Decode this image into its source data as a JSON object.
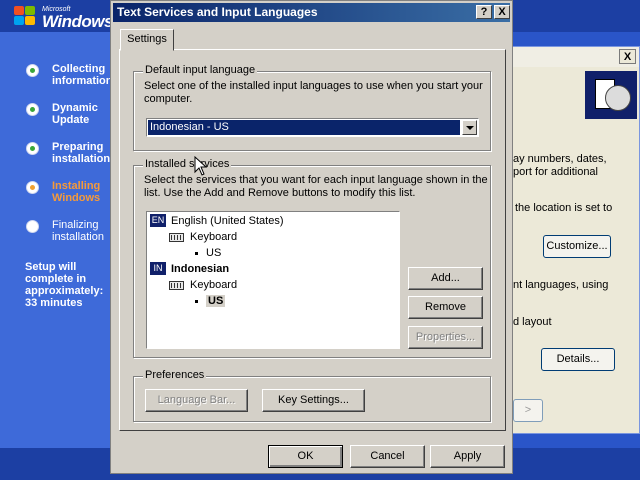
{
  "setup": {
    "logo_microsoft": "Microsoft",
    "logo_windows": "Windows",
    "steps": [
      {
        "label": "Collecting\ninformation",
        "state": "done"
      },
      {
        "label": "Dynamic\nUpdate",
        "state": "done"
      },
      {
        "label": "Preparing\ninstallation",
        "state": "done"
      },
      {
        "label": "Installing\nWindows",
        "state": "active"
      },
      {
        "label": "Finalizing\ninstallation",
        "state": "pending"
      }
    ],
    "time_remaining": "Setup will complete in\napproximately:\n33 minutes",
    "colors": {
      "done_dot": "#3aa63a",
      "active": "#f59a3a",
      "background": "#2a55c8"
    }
  },
  "background_dialog": {
    "close_icon": "close-icon",
    "text1": "ay numbers, dates,\nport for additional",
    "text2": "the location is set to",
    "customize_label": "Customize...",
    "text3": "nt languages, using",
    "text4": "d layout",
    "details_label": "Details...",
    "next_label": ">"
  },
  "dialog": {
    "title": "Text Services and Input Languages",
    "help_label": "?",
    "close_label": "X",
    "tab_label": "Settings",
    "default_input": {
      "legend": "Default input language",
      "description": "Select one of the installed input languages to use when you start your\ncomputer.",
      "selected_value": "Indonesian - US"
    },
    "installed": {
      "legend": "Installed services",
      "description": "Select the services that you want for each input language shown in the\nlist. Use the Add and Remove buttons to modify this list.",
      "tree": [
        {
          "code": "EN",
          "language": "English (United States)",
          "category": "Keyboard",
          "layout": "US"
        },
        {
          "code": "IN",
          "language": "Indonesian",
          "category": "Keyboard",
          "layout": "US"
        }
      ],
      "add_label": "Add...",
      "remove_label": "Remove",
      "properties_label": "Properties..."
    },
    "preferences": {
      "legend": "Preferences",
      "language_bar_label": "Language Bar...",
      "key_settings_label": "Key Settings..."
    },
    "ok_label": "OK",
    "cancel_label": "Cancel",
    "apply_label": "Apply",
    "colors": {
      "titlebar_start": "#0a246a",
      "titlebar_end": "#3a6ea5",
      "selection": "#0a246a",
      "face": "#d4d0c8"
    }
  }
}
